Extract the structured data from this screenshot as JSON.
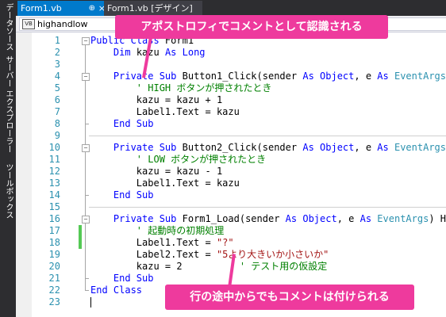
{
  "side_panels": [
    "データソース",
    "サーバー エクスプローラー",
    "ツールボックス"
  ],
  "tabs": [
    {
      "label": "Form1.vb",
      "pin": "⊕",
      "close": "×"
    },
    {
      "label": "Form1.vb [デザイン]"
    }
  ],
  "nav": {
    "icon_text": "VB",
    "member": "highandlow"
  },
  "code_lines": [
    {
      "n": "1",
      "parts": [
        [
          "kw",
          "Public Class "
        ],
        [
          "",
          "Form1"
        ]
      ]
    },
    {
      "n": "2",
      "parts": [
        [
          "",
          "    "
        ],
        [
          "kw",
          "Dim"
        ],
        [
          "",
          " kazu "
        ],
        [
          "kw",
          "As Long"
        ]
      ]
    },
    {
      "n": "3",
      "parts": []
    },
    {
      "n": "4",
      "parts": [
        [
          "",
          "    "
        ],
        [
          "kw",
          "Private Sub"
        ],
        [
          "",
          " Button1_Click(sender "
        ],
        [
          "kw",
          "As Object"
        ],
        [
          "",
          ", e "
        ],
        [
          "kw",
          "As"
        ],
        [
          "",
          " "
        ],
        [
          "ty",
          "EventArgs"
        ],
        [
          "",
          ") "
        ]
      ]
    },
    {
      "n": "5",
      "parts": [
        [
          "",
          "        "
        ],
        [
          "cm",
          "' HIGH ボタンが押されたとき"
        ]
      ]
    },
    {
      "n": "6",
      "parts": [
        [
          "",
          "        kazu = kazu + 1"
        ]
      ]
    },
    {
      "n": "7",
      "parts": [
        [
          "",
          "        Label1.Text = kazu"
        ]
      ]
    },
    {
      "n": "8",
      "parts": [
        [
          "",
          "    "
        ],
        [
          "kw",
          "End Sub"
        ]
      ]
    },
    {
      "n": "9",
      "parts": []
    },
    {
      "n": "10",
      "parts": [
        [
          "",
          "    "
        ],
        [
          "kw",
          "Private Sub"
        ],
        [
          "",
          " Button2_Click(sender "
        ],
        [
          "kw",
          "As Object"
        ],
        [
          "",
          ", e "
        ],
        [
          "kw",
          "As"
        ],
        [
          "",
          " "
        ],
        [
          "ty",
          "EventArgs"
        ],
        [
          "",
          ") "
        ]
      ]
    },
    {
      "n": "11",
      "parts": [
        [
          "",
          "        "
        ],
        [
          "cm",
          "' LOW ボタンが押されたとき"
        ]
      ]
    },
    {
      "n": "12",
      "parts": [
        [
          "",
          "        kazu = kazu - 1"
        ]
      ]
    },
    {
      "n": "13",
      "parts": [
        [
          "",
          "        Label1.Text = kazu"
        ]
      ]
    },
    {
      "n": "14",
      "parts": [
        [
          "",
          "    "
        ],
        [
          "kw",
          "End Sub"
        ]
      ]
    },
    {
      "n": "15",
      "parts": []
    },
    {
      "n": "16",
      "parts": [
        [
          "",
          "    "
        ],
        [
          "kw",
          "Private Sub"
        ],
        [
          "",
          " Form1_Load(sender "
        ],
        [
          "kw",
          "As Object"
        ],
        [
          "",
          ", e "
        ],
        [
          "kw",
          "As"
        ],
        [
          "",
          " "
        ],
        [
          "ty",
          "EventArgs"
        ],
        [
          "",
          ") Hand"
        ]
      ]
    },
    {
      "n": "17",
      "parts": [
        [
          "",
          "        "
        ],
        [
          "cm",
          "' 起動時の初期処理"
        ]
      ]
    },
    {
      "n": "18",
      "parts": [
        [
          "",
          "        Label1.Text = "
        ],
        [
          "st",
          "\"?\""
        ]
      ]
    },
    {
      "n": "19",
      "parts": [
        [
          "",
          "        Label2.Text = "
        ],
        [
          "st",
          "\"5より大きいか小さいか\""
        ]
      ]
    },
    {
      "n": "20",
      "parts": [
        [
          "",
          "        kazu = 2          "
        ],
        [
          "cm",
          "' テスト用の仮設定"
        ]
      ]
    },
    {
      "n": "21",
      "parts": [
        [
          "",
          "    "
        ],
        [
          "kw",
          "End Sub"
        ]
      ]
    },
    {
      "n": "22",
      "parts": [
        [
          "kw",
          "End Class"
        ]
      ]
    },
    {
      "n": "23",
      "parts": []
    }
  ],
  "callouts": {
    "top": "アポストロフィでコメントとして認識される",
    "bottom": "行の途中からでもコメントは付けられる"
  },
  "colors": {
    "keyword": "#0000ff",
    "type": "#2b91af",
    "comment": "#008000",
    "string": "#a31515",
    "accent": "#007acc",
    "callout": "#ee3a9d"
  }
}
